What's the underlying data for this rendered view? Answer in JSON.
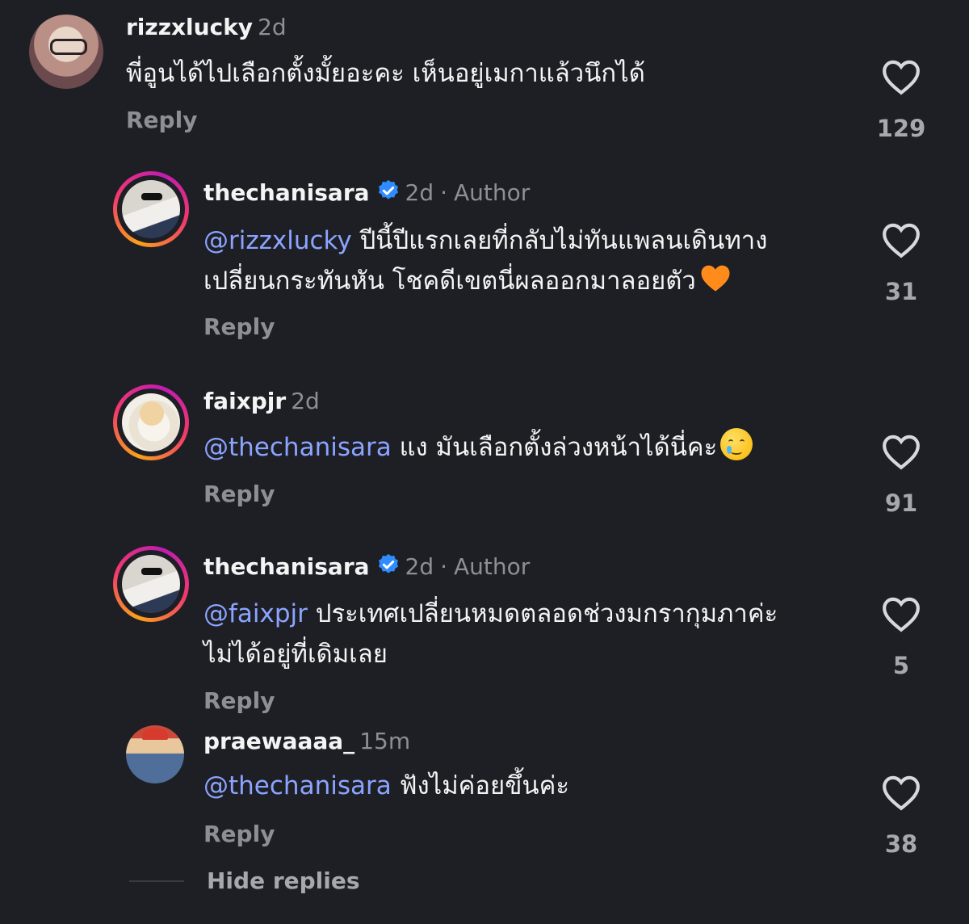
{
  "comments": [
    {
      "username": "rizzxlucky",
      "time": "2d",
      "text": "พี่อูนได้ไปเลือกตั้งมั้ยอะคะ เห็นอยู่เมกาแล้วนึกได้",
      "reply_label": "Reply",
      "likes": "129"
    },
    {
      "username": "thechanisara",
      "time": "2d",
      "author_label": "Author",
      "mention": "@rizzxlucky",
      "text_line1": " ปีนี้ปีแรกเลยที่กลับไม่ทันแพลนเดินทาง",
      "text_line2": "เปลี่ยนกระทันหัน โชคดีเขตนี่ผลออกมาลอยตัว",
      "reply_label": "Reply",
      "likes": "31"
    },
    {
      "username": "faixpjr",
      "time": "2d",
      "mention": "@thechanisara",
      "text": " แง มันเลือกตั้งล่วงหน้าได้นี่คะ",
      "reply_label": "Reply",
      "likes": "91"
    },
    {
      "username": "thechanisara",
      "time": "2d",
      "author_label": "Author",
      "mention": "@faixpjr",
      "text_line1": " ประเทศเปลี่ยนหมดตลอดช่วงมกรากุมภาค่ะ",
      "text_line2": "ไม่ได้อยู่ที่เดิมเลย",
      "reply_label": "Reply",
      "likes": "5"
    },
    {
      "username": "praewaaaa_",
      "time": "15m",
      "mention": "@thechanisara",
      "text": " ฟังไม่ค่อยขึ้นค่ะ",
      "reply_label": "Reply",
      "likes": "38"
    }
  ],
  "footer": {
    "hide_replies": "Hide replies"
  },
  "icons": {
    "like": "heart-outline-icon",
    "verified": "verified-badge-icon",
    "emoji_heart": "orange-heart-emoji",
    "emoji_tear": "smiling-face-with-tear-emoji"
  },
  "colors": {
    "background": "#1e1f25",
    "mention": "#8ba4ff",
    "muted": "#8e8f95",
    "verified": "#2f8cff"
  }
}
